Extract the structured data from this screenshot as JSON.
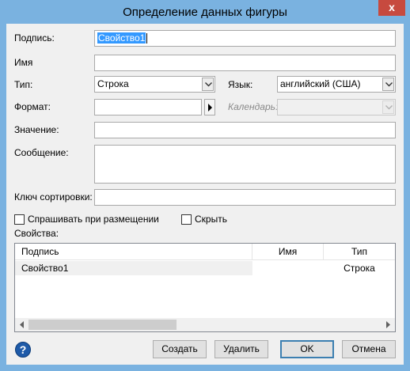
{
  "window": {
    "title": "Определение данных фигуры",
    "close_label": "x"
  },
  "form": {
    "caption_label": "Подпись:",
    "caption_value": "Свойство1",
    "name_label": "Имя",
    "name_value": "",
    "type_label": "Тип:",
    "type_value": "Строка",
    "language_label": "Язык:",
    "language_value": "английский (США)",
    "format_label": "Формат:",
    "format_value": "",
    "calendar_label": "Календарь:",
    "calendar_value": "",
    "value_label": "Значение:",
    "value_value": "",
    "prompt_label": "Сообщение:",
    "prompt_value": "",
    "sort_key_label": "Ключ сортировки:",
    "sort_key_value": "",
    "ask_on_drop_label": "Спрашивать при размещении",
    "ask_on_drop_checked": false,
    "hidden_label": "Скрыть",
    "hidden_checked": false
  },
  "properties": {
    "label": "Свойства:",
    "columns": [
      "Подпись",
      "Имя",
      "Тип"
    ],
    "rows": [
      {
        "caption": "Свойство1",
        "name": "",
        "type": "Строка"
      }
    ],
    "scroll_fraction": 0.42
  },
  "buttons": {
    "help_label": "?",
    "create": "Создать",
    "delete": "Удалить",
    "ok": "OK",
    "cancel": "Отмена"
  },
  "colors": {
    "titlebar": "#7ab2e0",
    "close": "#c74a3f",
    "selection": "#3399ff",
    "default_button_border": "#3c7fb1"
  }
}
